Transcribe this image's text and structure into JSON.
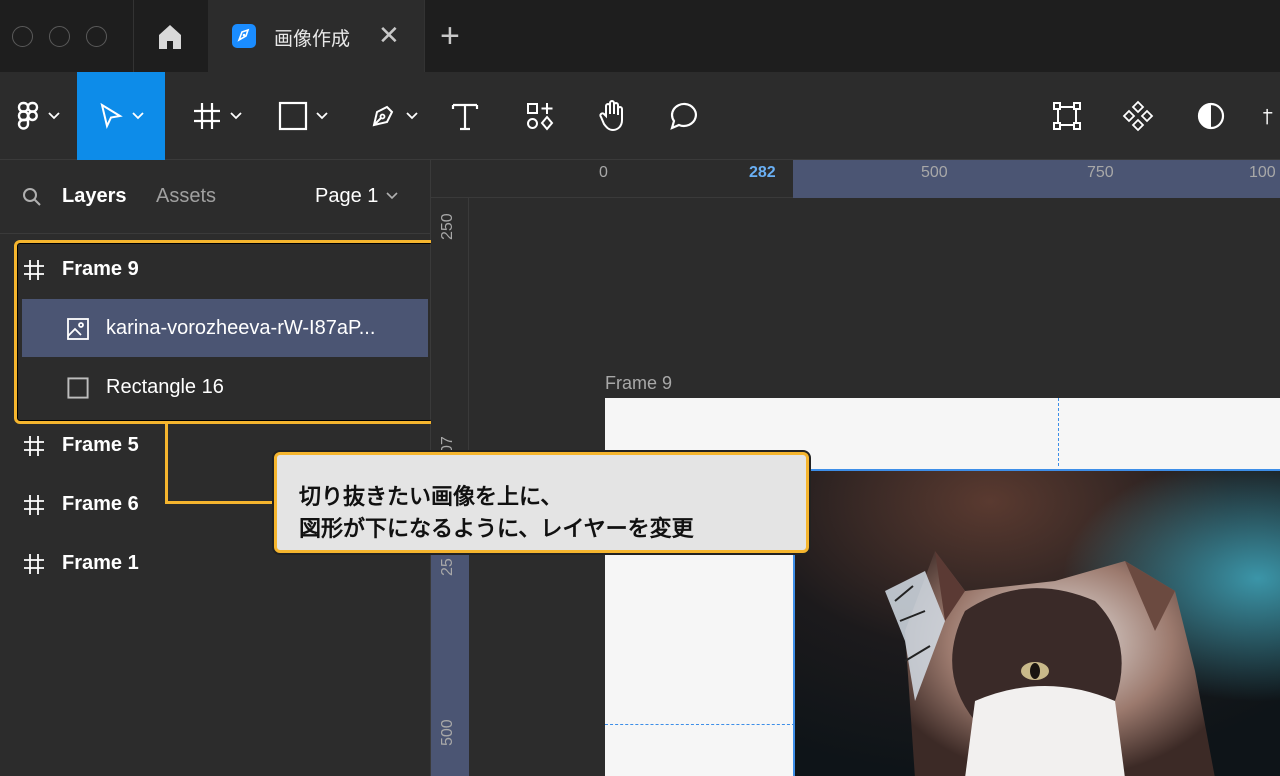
{
  "window": {
    "tab_title": "画像作成",
    "tab_icon": "figma-file-icon",
    "close_glyph": "✕",
    "add_glyph": "+"
  },
  "toolbar": {
    "tools": [
      "main-menu",
      "move",
      "frame",
      "shape",
      "pen",
      "text",
      "resources",
      "hand",
      "comment"
    ],
    "right_tools": [
      "component",
      "assets-grid",
      "contrast"
    ],
    "active_tool": "move",
    "accent": "#0d8ce9"
  },
  "left_panel": {
    "tab_layers": "Layers",
    "tab_assets": "Assets",
    "page_select": "Page 1",
    "layers": [
      {
        "label": "Frame 9",
        "type": "frame",
        "selected": false
      },
      {
        "label": "karina-vorozheeva-rW-I87aP...",
        "type": "image",
        "selected": true
      },
      {
        "label": "Rectangle 16",
        "type": "rectangle",
        "selected": false
      },
      {
        "label": "Frame 5",
        "type": "frame",
        "selected": false
      },
      {
        "label": "Frame 6",
        "type": "frame",
        "selected": false
      },
      {
        "label": "Frame 1",
        "type": "frame",
        "selected": false
      }
    ]
  },
  "rulers": {
    "top": [
      "0",
      "282",
      "500",
      "750",
      "100"
    ],
    "left": [
      "250",
      "07",
      "25",
      "500"
    ]
  },
  "canvas": {
    "frame_label": "Frame 9",
    "selection_color": "#3d8ee8"
  },
  "callout": {
    "line1": "切り抜きたい画像を上に、",
    "line2": "図形が下になるように、レイヤーを変更",
    "border_color": "#f5b52e"
  }
}
